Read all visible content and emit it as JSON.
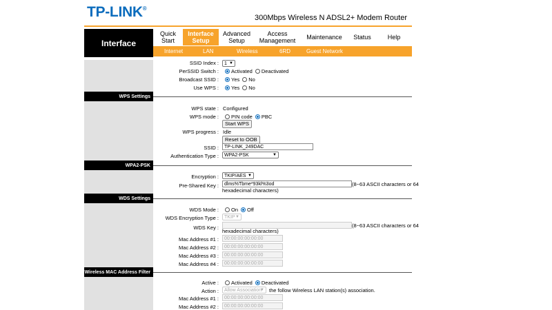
{
  "header": {
    "logo": "TP-LINK",
    "logo_mark": "®",
    "product": "300Mbps Wireless N ADSL2+ Modem Router",
    "left_title": "Interface"
  },
  "nav": [
    {
      "label": "Quick Start"
    },
    {
      "label": "Interface Setup"
    },
    {
      "label": "Advanced Setup"
    },
    {
      "label": "Access Management"
    },
    {
      "label": "Maintenance"
    },
    {
      "label": "Status"
    },
    {
      "label": "Help"
    }
  ],
  "subnav": [
    "Internet",
    "LAN",
    "Wireless",
    "6RD",
    "Guest Network"
  ],
  "top": {
    "ssid_index_label": "SSID Index :",
    "ssid_index_value": "1",
    "perssid_label": "PerSSID Switch :",
    "perssid_opt1": "Activated",
    "perssid_opt2": "Deactivated",
    "broadcast_label": "Broadcast SSID :",
    "yes": "Yes",
    "no": "No",
    "usewps_label": "Use WPS :"
  },
  "wps": {
    "title": "WPS Settings",
    "state_label": "WPS state :",
    "state_value": "Configured",
    "mode_label": "WPS mode :",
    "mode_opt1": "PIN code",
    "mode_opt2": "PBC",
    "start_btn": "Start WPS",
    "progress_label": "WPS progress :",
    "progress_value": "Idle",
    "reset_btn": "Reset to OOB",
    "ssid_label": "SSID :",
    "ssid_value": "TP-LINK_249DAC",
    "auth_label": "Authentication Type :",
    "auth_value": "WPA2-PSK"
  },
  "wpa": {
    "title": "WPA2-PSK",
    "enc_label": "Encryption :",
    "enc_value": "TKIP/AES",
    "psk_label": "Pre-Shared Key :",
    "psk_value": "dlms%Tbme*93kl%3od",
    "hint1": "(8~63 ASCII characters or 64",
    "hint2": "hexadecimal characters)"
  },
  "wds": {
    "title": "WDS Settings",
    "mode_label": "WDS Mode :",
    "on": "On",
    "off": "Off",
    "enc_label": "WDS Encryption Type :",
    "enc_value": "TKIP",
    "key_label": "WDS Key :",
    "hint1": "(8~63 ASCII characters or 64",
    "hint2": "hexadecimal characters)",
    "macs": [
      {
        "label": "Mac Address #1 :",
        "value": "00:00:00:00:00:00"
      },
      {
        "label": "Mac Address #2 :",
        "value": "00:00:00:00:00:00"
      },
      {
        "label": "Mac Address #3 :",
        "value": "00:00:00:00:00:00"
      },
      {
        "label": "Mac Address #4 :",
        "value": "00:00:00:00:00:00"
      }
    ]
  },
  "macfilter": {
    "title": "Wireless MAC Address Filter",
    "active_label": "Active :",
    "opt1": "Activated",
    "opt2": "Deactivated",
    "action_label": "Action :",
    "action_value": "Allow Association",
    "action_note": "the follow Wireless LAN station(s) association.",
    "macs": [
      {
        "label": "Mac Address #1 :",
        "value": "00:00:00:00:00:00"
      },
      {
        "label": "Mac Address #2 :",
        "value": "00:00:00:00:00:00"
      }
    ]
  },
  "colors": {
    "orange": "#f7a32b",
    "logo_blue": "#0b6cbd"
  }
}
